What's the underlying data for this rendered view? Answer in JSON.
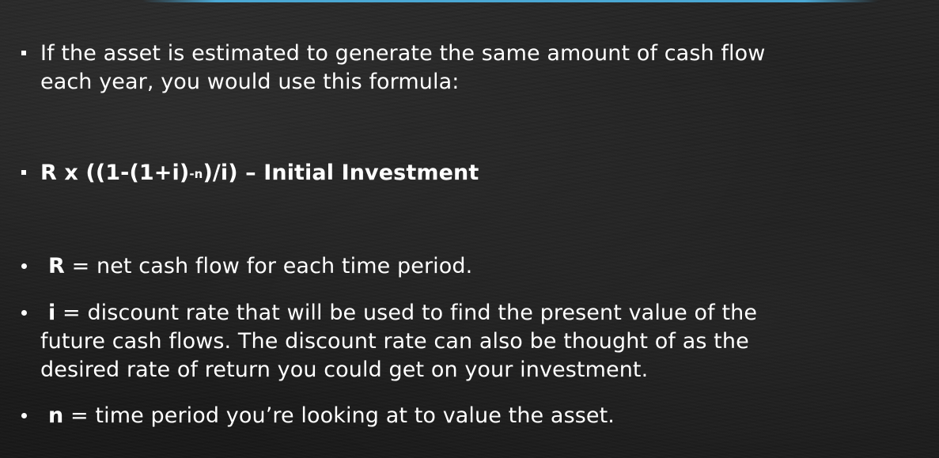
{
  "bullet1": {
    "line1": "If the asset is estimated to generate the same amount of cash flow",
    "line2": "each year, you would use this formula:"
  },
  "formula": {
    "before": "R x ((1-(1+i)",
    "exponent": "-n",
    "after": ")/i) – Initial Investment"
  },
  "definitions": [
    {
      "term": "R",
      "text": " = net cash flow for each time period."
    },
    {
      "term": "i",
      "text": " = discount rate that will be used to find the present value of the",
      "line2": "future cash flows. The discount rate can also be thought of as the",
      "line3": "desired rate of return you could get on your investment."
    },
    {
      "term": "n",
      "text": " = time period you’re looking at to value the asset."
    }
  ]
}
